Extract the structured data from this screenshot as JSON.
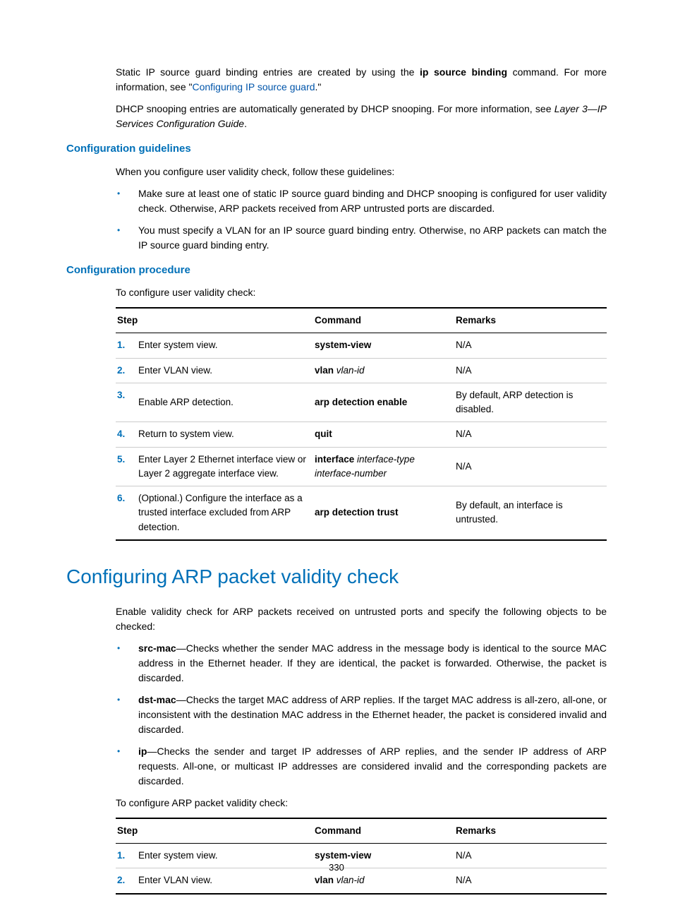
{
  "intro": {
    "p1a": "Static IP source guard binding entries are created by using the ",
    "p1b": "ip source binding",
    "p1c": " command. For more information, see \"",
    "p1link": "Configuring IP source guard",
    "p1d": ".\"",
    "p2a": "DHCP snooping entries are automatically generated by DHCP snooping. For more information, see ",
    "p2b": "Layer 3—IP Services Configuration Guide",
    "p2c": "."
  },
  "guidelines": {
    "heading": "Configuration guidelines",
    "intro": "When you configure user validity check, follow these guidelines:",
    "b1": "Make sure at least one of static IP source guard binding and DHCP snooping is configured for user validity check. Otherwise, ARP packets received from ARP untrusted ports are discarded.",
    "b2": "You must specify a VLAN for an IP source guard binding entry. Otherwise, no ARP packets can match the IP source guard binding entry."
  },
  "procedure": {
    "heading": "Configuration procedure",
    "intro": "To configure user validity check:",
    "table": {
      "headers": {
        "step": "Step",
        "command": "Command",
        "remarks": "Remarks"
      },
      "rows": [
        {
          "n": "1.",
          "step": "Enter system view.",
          "cmd_b": "system-view",
          "cmd_i": "",
          "rem": "N/A"
        },
        {
          "n": "2.",
          "step": "Enter VLAN view.",
          "cmd_b": "vlan",
          "cmd_i": " vlan-id",
          "rem": "N/A"
        },
        {
          "n": "3.",
          "step": "Enable ARP detection.",
          "cmd_b": "arp detection enable",
          "cmd_i": "",
          "rem": "By default, ARP detection is disabled."
        },
        {
          "n": "4.",
          "step": "Return to system view.",
          "cmd_b": "quit",
          "cmd_i": "",
          "rem": "N/A"
        },
        {
          "n": "5.",
          "step": "Enter Layer 2 Ethernet interface view or Layer 2 aggregate interface view.",
          "cmd_b": "interface",
          "cmd_i": " interface-type interface-number",
          "rem": "N/A"
        },
        {
          "n": "6.",
          "step": "(Optional.) Configure the interface as a trusted interface excluded from ARP detection.",
          "cmd_b": "arp detection trust",
          "cmd_i": "",
          "rem": "By default, an interface is untrusted."
        }
      ]
    }
  },
  "validity": {
    "heading": "Configuring ARP packet validity check",
    "intro": "Enable validity check for ARP packets received on untrusted ports and specify the following objects to be checked:",
    "b1a": "src-mac",
    "b1b": "—Checks whether the sender MAC address in the message body is identical to the source MAC address in the Ethernet header. If they are identical, the packet is forwarded. Otherwise, the packet is discarded.",
    "b2a": "dst-mac",
    "b2b": "—Checks the target MAC address of ARP replies. If the target MAC address is all-zero, all-one, or inconsistent with the destination MAC address in the Ethernet header, the packet is considered invalid and discarded.",
    "b3a": "ip",
    "b3b": "—Checks the sender and target IP addresses of ARP replies, and the sender IP address of ARP requests. All-one, or multicast IP addresses are considered invalid and the corresponding packets are discarded.",
    "intro2": "To configure ARP packet validity check:",
    "table": {
      "headers": {
        "step": "Step",
        "command": "Command",
        "remarks": "Remarks"
      },
      "rows": [
        {
          "n": "1.",
          "step": "Enter system view.",
          "cmd_b": "system-view",
          "cmd_i": "",
          "rem": "N/A"
        },
        {
          "n": "2.",
          "step": "Enter VLAN view.",
          "cmd_b": "vlan",
          "cmd_i": " vlan-id",
          "rem": "N/A"
        }
      ]
    }
  },
  "page": "330"
}
